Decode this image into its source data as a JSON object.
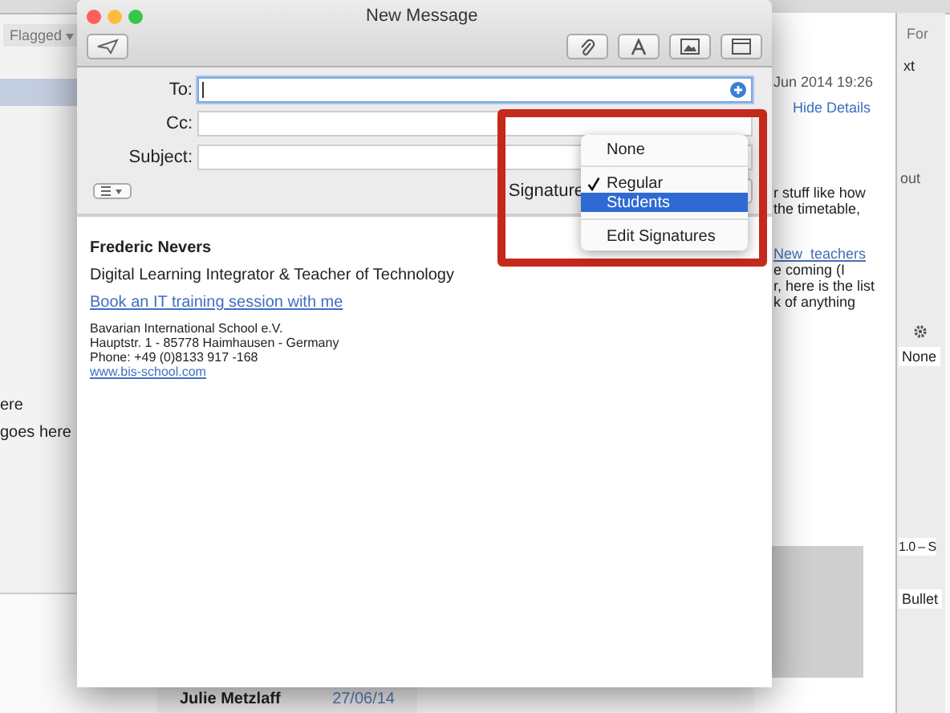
{
  "background_app": {
    "filter_button": "Flagged",
    "sidebar_texts": [
      "ere",
      "goes here"
    ],
    "message_header": {
      "date": "Jun 2014 19:26",
      "link": "Hide Details"
    },
    "message_body": [
      {
        "kind": "text",
        "text": "r stuff like how"
      },
      {
        "kind": "text",
        "text": "the timetable,"
      },
      {
        "kind": "link",
        "text": "New_teachers"
      },
      {
        "kind": "text",
        "text": "e coming (I"
      },
      {
        "kind": "text",
        "text": "r, here is the list"
      },
      {
        "kind": "text",
        "text": "k of anything"
      }
    ],
    "message_list_item": {
      "sender": "Julie Metzlaff",
      "date": "27/06/14"
    },
    "inspector": {
      "tab": "For",
      "label": "xt",
      "column": "out",
      "style_value": "None",
      "spacing_value": "1.0 – S",
      "list_value": "Bullet"
    }
  },
  "compose": {
    "title": "New Message",
    "fields": [
      {
        "label": "To:",
        "focused": true
      },
      {
        "label": "Cc:",
        "focused": false
      },
      {
        "label": "Subject:",
        "focused": false
      }
    ],
    "signature_label": "Signature",
    "signature_menu": [
      {
        "label": "None",
        "checked": false,
        "selected": false
      },
      {
        "label": "Regular",
        "checked": true,
        "selected": false
      },
      {
        "label": "Students",
        "checked": false,
        "selected": true
      },
      {
        "label": "Edit Signatures",
        "checked": false,
        "selected": false
      }
    ],
    "signature": {
      "name": "Frederic Nevers",
      "role": "Digital Learning Integrator & Teacher of Technology",
      "booking_link": "Book an IT training session with me",
      "address_lines": [
        "Bavarian International School e.V.",
        "Hauptstr. 1 - 85778 Haimhausen - Germany",
        "Phone: +49 (0)8133 917 -168"
      ],
      "website": "www.bis-school.com"
    }
  }
}
